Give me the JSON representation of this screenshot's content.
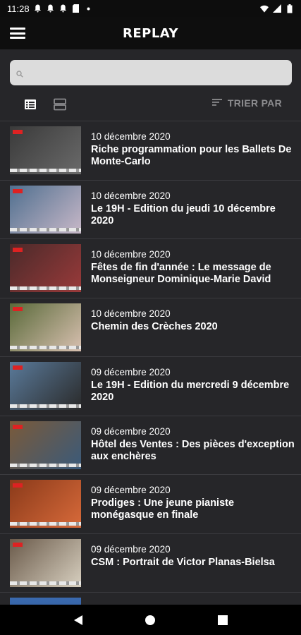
{
  "status_bar": {
    "time": "11:28"
  },
  "app_bar": {
    "title": "REPLAY"
  },
  "search": {
    "placeholder": ""
  },
  "toolbar": {
    "sort_label": "TRIER PAR"
  },
  "items": [
    {
      "date": "10 décembre 2020",
      "title": "Riche programmation pour les Ballets De Monte-Carlo",
      "thumb_colors": [
        "#3a3a3a",
        "#6a6a6a"
      ]
    },
    {
      "date": "10 décembre 2020",
      "title": "Le 19H - Edition du jeudi 10 décembre 2020",
      "thumb_colors": [
        "#4f6f8f",
        "#c8b8c8"
      ]
    },
    {
      "date": "10 décembre 2020",
      "title": "Fêtes de fin d'année : Le message de Monseigneur Dominique-Marie David",
      "thumb_colors": [
        "#4a2a2a",
        "#9a3a3a"
      ]
    },
    {
      "date": "10 décembre 2020",
      "title": "Chemin des Crèches 2020",
      "thumb_colors": [
        "#5a6a3a",
        "#d8c0b0"
      ]
    },
    {
      "date": "09 décembre 2020",
      "title": "Le 19H - Edition du mercredi 9 décembre 2020",
      "thumb_colors": [
        "#5a7a9a",
        "#2a2a2a"
      ]
    },
    {
      "date": "09 décembre 2020",
      "title": "Hôtel des Ventes : Des pièces d'exception aux enchères",
      "thumb_colors": [
        "#7a5a3a",
        "#3a5a7a"
      ]
    },
    {
      "date": "09 décembre 2020",
      "title": "Prodiges : Une jeune pianiste monégasque en finale",
      "thumb_colors": [
        "#8a3a1a",
        "#d86a3a"
      ]
    },
    {
      "date": "09 décembre 2020",
      "title": "CSM : Portrait de Victor Planas-Bielsa",
      "thumb_colors": [
        "#6a5a4a",
        "#d8d0c0"
      ]
    }
  ],
  "colors": {
    "content_bg": "#262629",
    "app_bar_bg": "#0e0e0e",
    "search_bg": "#dcdcdc",
    "sort_text": "#8c8c8f"
  }
}
